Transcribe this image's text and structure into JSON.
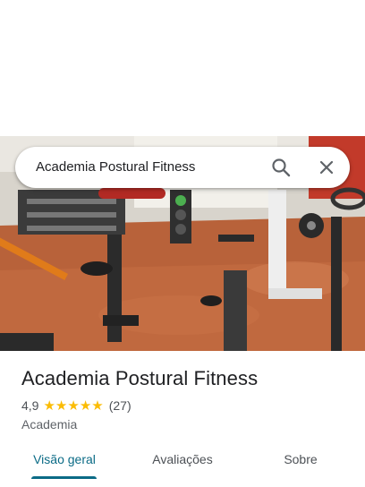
{
  "search": {
    "query": "Academia Postural Fitness",
    "search_icon": "search-icon",
    "close_icon": "close-icon"
  },
  "place": {
    "name": "Academia Postural Fitness",
    "rating": "4,9",
    "stars": 5,
    "review_count": "(27)",
    "category": "Academia"
  },
  "tabs": [
    {
      "label": "Visão geral",
      "active": true
    },
    {
      "label": "Avaliações",
      "active": false
    },
    {
      "label": "Sobre",
      "active": false
    }
  ],
  "colors": {
    "accent": "#0b6b86",
    "star": "#fbbc04"
  }
}
